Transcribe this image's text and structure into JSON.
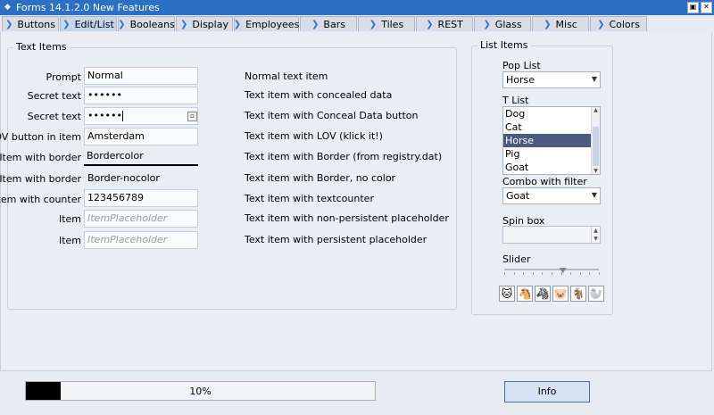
{
  "window": {
    "title": "Forms 14.1.2.0 New Features",
    "buttons": [
      "▣",
      "✕"
    ]
  },
  "tabs": [
    {
      "label": "Buttons"
    },
    {
      "label": "Edit/List",
      "active": true
    },
    {
      "label": "Booleans"
    },
    {
      "label": "Display"
    },
    {
      "label": "Employees"
    },
    {
      "label": "Bars"
    },
    {
      "label": "Tiles"
    },
    {
      "label": "REST"
    },
    {
      "label": "Glass"
    },
    {
      "label": "Misc"
    },
    {
      "label": "Colors"
    }
  ],
  "text_items": {
    "group_title": "Text Items",
    "rows": [
      {
        "label": "Prompt",
        "value": "Normal",
        "desc": "Normal text item"
      },
      {
        "label": "Secret text",
        "value": "••••••",
        "desc": "Text item with concealed data"
      },
      {
        "label": "Secret text",
        "value": "••••••",
        "desc": "Text item with Conceal Data button"
      },
      {
        "label": "LOV button in item",
        "value": "Amsterdam",
        "desc": "Text item with LOV (klick it!)"
      },
      {
        "label": "Item with border",
        "value": "Bordercolor",
        "desc": "Text item with Border (from registry.dat)"
      },
      {
        "label": "Item with border",
        "value": "Border-nocolor",
        "desc": "Text item with Border, no color"
      },
      {
        "label": "Item with counter",
        "value": "123456789",
        "desc": "Text item with textcounter"
      },
      {
        "label": "Item",
        "placeholder": "ItemPlaceholder",
        "desc": "Text item with non-persistent placeholder"
      },
      {
        "label": "Item",
        "placeholder": "ItemPlaceholder",
        "desc": "Text item with persistent placeholder"
      }
    ]
  },
  "list_items": {
    "group_title": "List Items",
    "pop_list": {
      "label": "Pop List",
      "value": "Horse"
    },
    "t_list": {
      "label": "T List",
      "items": [
        "Dog",
        "Cat",
        "Horse",
        "Pig",
        "Goat"
      ],
      "selected": "Horse"
    },
    "combo": {
      "label": "Combo with filter",
      "value": "Goat"
    },
    "spin": {
      "label": "Spin box",
      "value": ""
    },
    "slider": {
      "label": "Slider",
      "position": 0.62
    },
    "animals": [
      "🐱",
      "🐴",
      "🦓",
      "🐷",
      "🐐",
      "🦭"
    ]
  },
  "progress": {
    "value": 10,
    "text": "10%"
  },
  "info_button": {
    "label": "Info"
  },
  "colors": {
    "accent": "#2b6fc6",
    "selection": "#4a5a80"
  }
}
